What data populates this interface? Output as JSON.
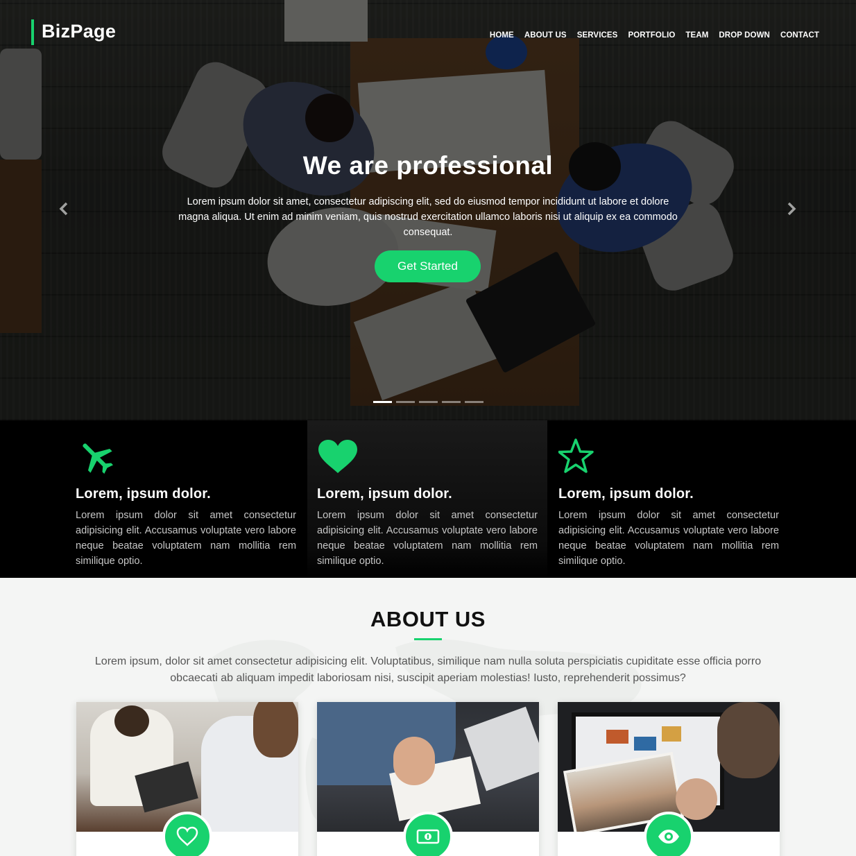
{
  "brand": {
    "name": "BizPage",
    "accent_color": "#18d26e"
  },
  "nav": {
    "items": [
      "HOME",
      "ABOUT US",
      "SERVICES",
      "PORTFOLIO",
      "TEAM",
      "DROP DOWN",
      "CONTACT"
    ]
  },
  "hero": {
    "title": "We are professional",
    "text": "Lorem ipsum dolor sit amet, consectetur adipiscing elit, sed do eiusmod tempor incididunt ut labore et dolore magna aliqua. Ut enim ad minim veniam, quis nostrud exercitation ullamco laboris nisi ut aliquip ex ea commodo consequat.",
    "button_label": "Get Started",
    "prev_icon": "chevron-left-icon",
    "next_icon": "chevron-right-icon",
    "slide_count": 5,
    "active_slide": 1
  },
  "features": [
    {
      "icon": "plane-icon",
      "title": "Lorem, ipsum dolor.",
      "text": "Lorem ipsum dolor sit amet consectetur adipisicing elit. Accusamus voluptate vero labore neque beatae voluptatem nam mollitia rem similique optio."
    },
    {
      "icon": "heart-icon",
      "title": "Lorem, ipsum dolor.",
      "text": "Lorem ipsum dolor sit amet consectetur adipisicing elit. Accusamus voluptate vero labore neque beatae voluptatem nam mollitia rem similique optio."
    },
    {
      "icon": "star-icon",
      "title": "Lorem, ipsum dolor.",
      "text": "Lorem ipsum dolor sit amet consectetur adipisicing elit. Accusamus voluptate vero labore neque beatae voluptatem nam mollitia rem similique optio."
    }
  ],
  "about": {
    "title": "ABOUT US",
    "text": "Lorem ipsum, dolor sit amet consectetur adipisicing elit. Voluptatibus, similique nam nulla soluta perspiciatis cupiditate esse officia porro obcaecati ab aliquam impedit laboriosam nisi, suscipit aperiam molestias! Iusto, reprehenderit possimus?",
    "cards": [
      {
        "icon": "heart-outline-icon"
      },
      {
        "icon": "money-icon"
      },
      {
        "icon": "eye-icon"
      }
    ]
  }
}
